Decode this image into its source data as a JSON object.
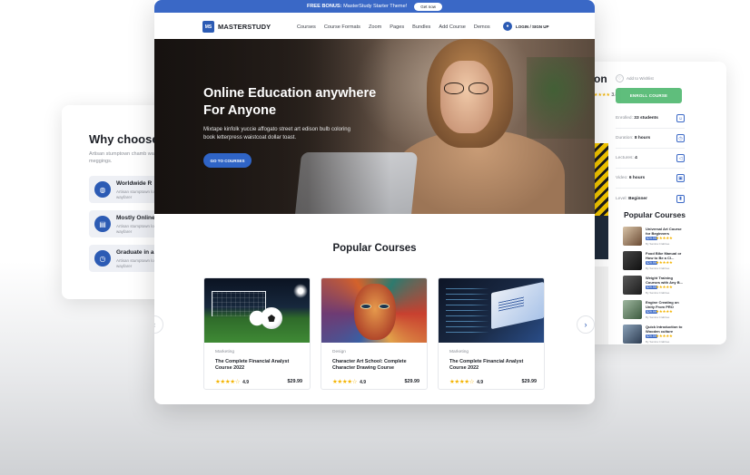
{
  "left_card": {
    "title": "Why choose",
    "subtitle": "Artisan stumptown chamb wayfarers meggings.",
    "items": [
      {
        "title": "Worldwide R",
        "desc": "Artisan stumptown locavore wayfarer",
        "icon": "globe-icon"
      },
      {
        "title": "Mostly Online",
        "desc": "Artisan stumptown locavore wayfarer",
        "icon": "book-icon"
      },
      {
        "title": "Graduate in a",
        "desc": "Artisan stumptown locavore wayfarer",
        "icon": "clock-icon"
      }
    ]
  },
  "right_card": {
    "title_fragment": "on",
    "rating": "3.8",
    "wishlist": "Add to Wishlist",
    "enroll": "ENROLL COURSE",
    "info": [
      {
        "label": "Enrolled",
        "value": "33 students",
        "icon": "users-icon"
      },
      {
        "label": "Duration",
        "value": "8 hours",
        "icon": "clock-icon"
      },
      {
        "label": "Lectures",
        "value": "4",
        "icon": "megaphone-icon"
      },
      {
        "label": "Video",
        "value": "6 hours",
        "icon": "video-icon"
      },
      {
        "label": "Level",
        "value": "Beginner",
        "icon": "level-icon"
      }
    ],
    "popular_title": "Popular Courses",
    "popular": [
      {
        "name": "Universal Art Course for Beginners",
        "price": "$29.99",
        "by": "By Samira Crabtree"
      },
      {
        "name": "Food Bike Manual or How to Be a Cl...",
        "price": "$29.99",
        "by": "By Samira Crabtree"
      },
      {
        "name": "Weight Training Courses with Any B...",
        "price": "$29.99",
        "by": "By Samira Crabtree"
      },
      {
        "name": "Engine Creating on Unity From PRO",
        "price": "$29.99",
        "by": "By Samira Crabtree"
      },
      {
        "name": "Quick Introduction to Wooden culture",
        "price": "$29.99",
        "by": "By Samira Crabtree"
      }
    ]
  },
  "promo": {
    "text_bold": "FREE BONUS:",
    "text": "MasterStudy Starter Theme!",
    "button": "Get now"
  },
  "nav": {
    "logo_mark": "MS",
    "logo_text": "MASTERSTUDY",
    "menu": [
      "Courses",
      "Course Formats",
      "Zoom",
      "Pages",
      "Bundles",
      "Add Course",
      "Demos"
    ],
    "login": "LOGIN / SIGN UP"
  },
  "hero": {
    "title": "Online Education anywhere For Anyone",
    "description": "Mixtape kinfolk yuccie affogato street art edison bulb coloring book letterpress waistcoat dollar toast.",
    "cta": "GO TO COURSES"
  },
  "popular": {
    "title": "Popular Courses",
    "courses": [
      {
        "category": "Marketing",
        "title": "The Complete Financial Analyst Course 2022",
        "rating": "4.9",
        "price": "$29.99",
        "stars": "★★★★☆",
        "image": "soccer"
      },
      {
        "category": "Design",
        "title": "Character Art School: Complete Character Drawing Course",
        "rating": "4.9",
        "price": "$29.99",
        "stars": "★★★★☆",
        "image": "art"
      },
      {
        "category": "Marketing",
        "title": "The Complete Financial Analyst Course 2022",
        "rating": "4.9",
        "price": "$29.99",
        "stars": "★★★★☆",
        "image": "code"
      }
    ]
  },
  "colors": {
    "primary": "#3a68c6",
    "accent_green": "#5fbe7c",
    "star": "#f4b400"
  }
}
